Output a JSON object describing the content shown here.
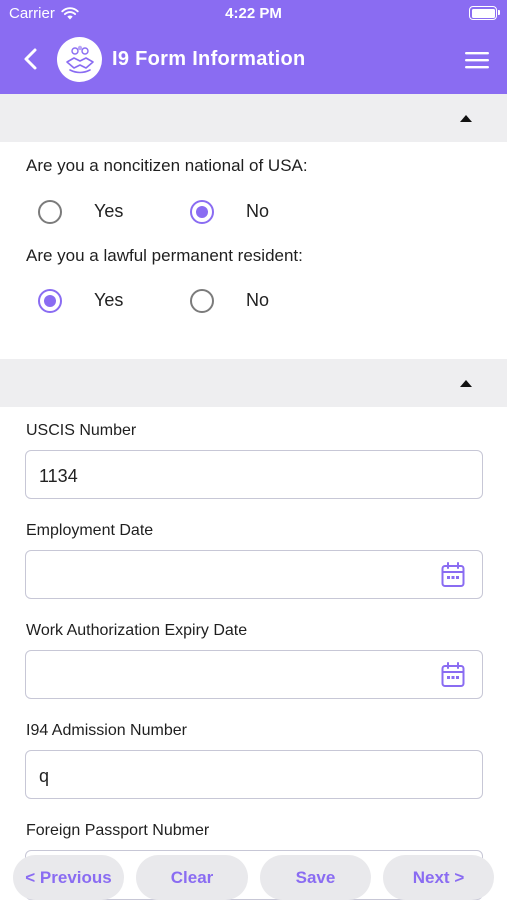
{
  "status_bar": {
    "carrier": "Carrier",
    "time": "4:22 PM"
  },
  "nav": {
    "title": "I9 Form Information"
  },
  "questions": [
    {
      "text": "Are you a noncitizen national of USA:",
      "options": [
        "Yes",
        "No"
      ],
      "selected": "No"
    },
    {
      "text": "Are you a lawful permanent resident:",
      "options": [
        "Yes",
        "No"
      ],
      "selected": "Yes"
    }
  ],
  "fields": {
    "uscis": {
      "label": "USCIS Number",
      "value": "1134"
    },
    "employment_date": {
      "label": "Employment Date",
      "value": ""
    },
    "work_auth_expiry": {
      "label": "Work Authorization Expiry Date",
      "value": ""
    },
    "i94": {
      "label": "I94 Admission Number",
      "value": "q"
    },
    "passport": {
      "label": "Foreign Passport Nubmer",
      "value": ""
    }
  },
  "buttons": {
    "previous": "< Previous",
    "clear": "Clear",
    "save": "Save",
    "next": "Next >"
  },
  "colors": {
    "accent": "#8a6cf2",
    "section_bg": "#eeeef0"
  }
}
